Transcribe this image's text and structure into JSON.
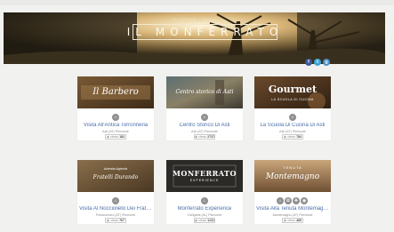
{
  "hero": {
    "brand": "TRAVELER · GUIDE",
    "title": "IL MONFERRATO",
    "social": [
      {
        "icon": "facebook-icon",
        "glyph": "f",
        "color": "#3b5998"
      },
      {
        "icon": "twitter-icon",
        "glyph": "t",
        "color": "#3ba9d9"
      },
      {
        "icon": "google-plus-icon",
        "glyph": "g",
        "color": "#4a90c8"
      }
    ]
  },
  "cards": [
    {
      "thumb": "Il Barbero",
      "title": "Visita All'Antica Torronneria",
      "subtitle": "Asti (AT) Piemonte",
      "views_label": "views",
      "views": "182",
      "pins": [
        {
          "glyph": "⌂"
        }
      ]
    },
    {
      "thumb": "Centro storico di Asti",
      "title": "Centro Storico Di Asti",
      "subtitle": "Asti (AT) Piemonte",
      "views_label": "views",
      "views": "2737",
      "pins": [
        {
          "glyph": "⌂"
        }
      ]
    },
    {
      "thumb": "Gourmet",
      "thumb_sub": "LA SCUOLA DI CUCINA",
      "title": "La Scuola Di Cucina Di Asti",
      "subtitle": "Asti (AT) Piemonte",
      "views_label": "views",
      "views": "784",
      "pins": [
        {
          "glyph": "⌂"
        }
      ]
    },
    {
      "thumb": "Fratelli Durando",
      "thumb_sub": "Azienda Agricola",
      "title": "Visita Al Nocciolieto Dei Fratel...",
      "subtitle": "Portacomaro (AT) Piemonte",
      "views_label": "views",
      "views": "767",
      "pins": [
        {
          "glyph": "⌂"
        }
      ]
    },
    {
      "thumb": "MONFERRATO",
      "thumb_sub": "EXPERIENCE",
      "title": "Monferrato Experience",
      "subtitle": "Calligaris (AL) Piemonte",
      "views_label": "views",
      "views": "1131",
      "pins": [
        {
          "glyph": "⌂"
        }
      ]
    },
    {
      "thumb": "Montemagno",
      "thumb_sub": "TENUTA",
      "title": "Visita Alla Tenuta Montemagno",
      "subtitle": "Montemagno (AT) Piemonte",
      "views_label": "views",
      "views": "489",
      "pins": [
        {
          "glyph": "⌂"
        },
        {
          "glyph": "✿"
        },
        {
          "glyph": "✚"
        },
        {
          "glyph": "◉"
        }
      ]
    }
  ]
}
